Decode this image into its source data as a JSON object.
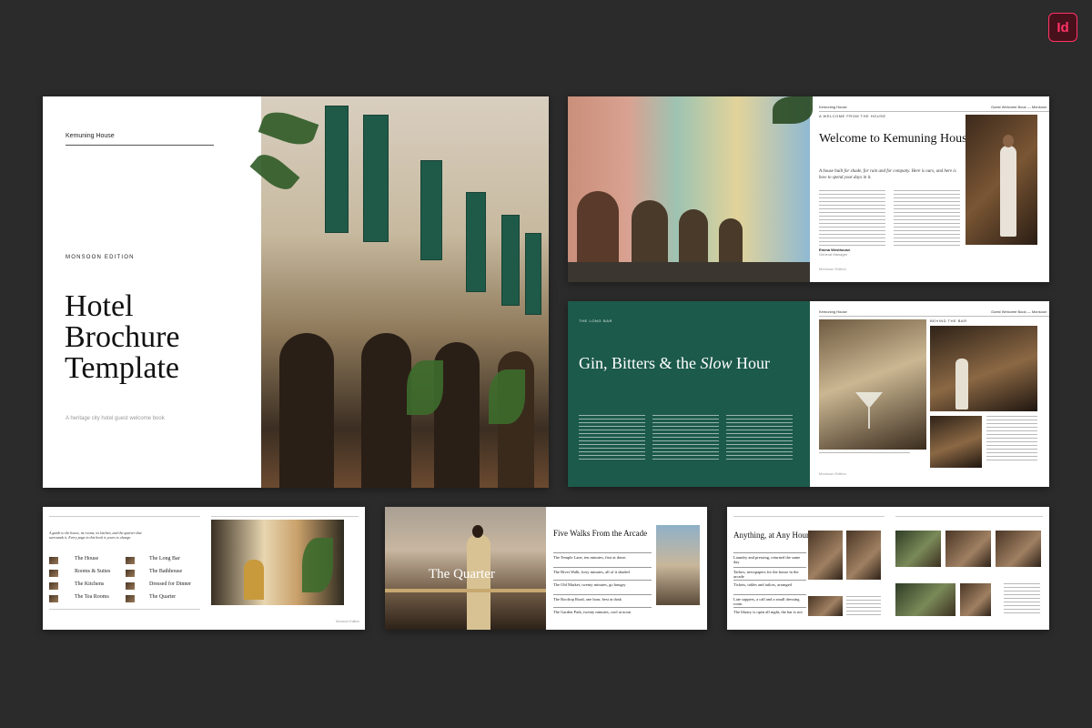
{
  "app_badge": "Id",
  "cover": {
    "brand": "Kemuning House",
    "edition": "MONSOON EDITION",
    "title_lines": [
      "Hotel",
      "Brochure",
      "Template"
    ],
    "subtitle": "A heritage city hotel guest welcome book"
  },
  "welcome": {
    "header_left": "Kemuning House",
    "header_right": "Guest Welcome Book — Monsoon",
    "section": "A WELCOME FROM THE HOUSE",
    "title": "Welcome to Kemuning House",
    "lede": "A house built for shade, for rain and for company. Here is ours, and here is how to spend your days in it.",
    "signature_name": "Emma Westhouse",
    "signature_role": "General Manager",
    "footer": "Monsoon Edition"
  },
  "long_bar": {
    "section": "THE LONG BAR",
    "title_pre": "Gin, Bitters & the ",
    "title_em": "Slow",
    "title_post": " Hour",
    "header_left": "Kemuning House",
    "header_right": "Guest Welcome Book — Monsoon",
    "section_right": "BEHIND THE BAR",
    "footer": "Monsoon Edition"
  },
  "toc": {
    "intro": "A guide to the house, its rooms, its kitchen, and the quarter that surrounds it. Every page in this book is yours to change.",
    "items_left": [
      "The House",
      "Rooms & Suites",
      "The Kitchens",
      "The Tea Rooms"
    ],
    "items_right": [
      "The Long Bar",
      "The Bathhouse",
      "Dressed for Dinner",
      "The Quarter"
    ],
    "footer": "Monsoon Edition"
  },
  "quarter": {
    "title": "The Quarter",
    "walks_title": "Five Walks From the Arcade",
    "walks": [
      "The Temple Lane, ten minutes, first at dawn",
      "The River Walk, forty minutes, all of it shaded",
      "The Old Market, twenty minutes, go hungry",
      "The Rooftop Road, one hour, best at dusk",
      "The Garden Park, twenty minutes, cool at noon"
    ]
  },
  "anything": {
    "title": "Anything, at Any Hour",
    "items": [
      "Laundry and pressing, returned the same day",
      "Tailors, newspapers for the house in the arcade",
      "Tickets, tables and tailors, arranged",
      "Late suppers, a call and a small dressing room",
      "The library is open all night, the bar is not"
    ]
  }
}
